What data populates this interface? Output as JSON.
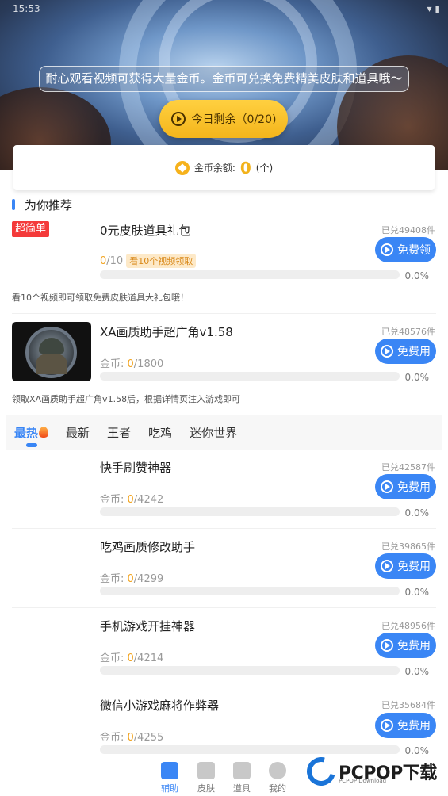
{
  "status_bar": {
    "time": "15:53"
  },
  "banner": {
    "notice": "耐心观看视频可获得大量金币。金币可兑换免费精美皮肤和道具哦～",
    "watch_button": "今日剩余（0/20)"
  },
  "coin": {
    "label": "金币余额:",
    "value": "0",
    "unit": "(个)"
  },
  "recommend": {
    "title": "为你推荐",
    "items": [
      {
        "badge": "超简单",
        "name": "0元皮肤道具礼包",
        "sold": "已兑49408件",
        "cur": "0",
        "total": "/10",
        "tag": "看10个视频领取",
        "percent": "0.0%",
        "progress": 0,
        "button": "免费领",
        "desc": "看10个视频即可领取免费皮肤道具大礼包哦！"
      },
      {
        "name": "XA画质助手超广角v1.58",
        "sold": "已兑48576件",
        "coin_label": "金币: ",
        "cur": "0",
        "total": "/1800",
        "percent": "0.0%",
        "progress": 0,
        "button": "免费用",
        "desc": "领取XA画质助手超广角v1.58后，根据详情页注入游戏即可"
      }
    ]
  },
  "tabs": [
    "最热",
    "最新",
    "王者",
    "吃鸡",
    "迷你世界"
  ],
  "list": [
    {
      "name": "快手刷赞神器",
      "sold": "已兑42587件",
      "coin_label": "金币: ",
      "cur": "0",
      "total": "/4242",
      "percent": "0.0%",
      "progress": 0,
      "button": "免费用"
    },
    {
      "name": "吃鸡画质修改助手",
      "sold": "已兑39865件",
      "coin_label": "金币: ",
      "cur": "0",
      "total": "/4299",
      "percent": "0.0%",
      "progress": 0,
      "button": "免费用"
    },
    {
      "name": "手机游戏开挂神器",
      "sold": "已兑48956件",
      "coin_label": "金币: ",
      "cur": "0",
      "total": "/4214",
      "percent": "0.0%",
      "progress": 0,
      "button": "免费用"
    },
    {
      "name": "微信小游戏麻将作弊器",
      "sold": "已兑35684件",
      "coin_label": "金币: ",
      "cur": "0",
      "total": "/4255",
      "percent": "0.0%",
      "progress": 0,
      "button": "免费用"
    }
  ],
  "bottom_nav": [
    "辅助",
    "皮肤",
    "道具",
    "我的"
  ],
  "watermark": {
    "text": "PCPOP下载",
    "sub": "PCPOP Download"
  }
}
